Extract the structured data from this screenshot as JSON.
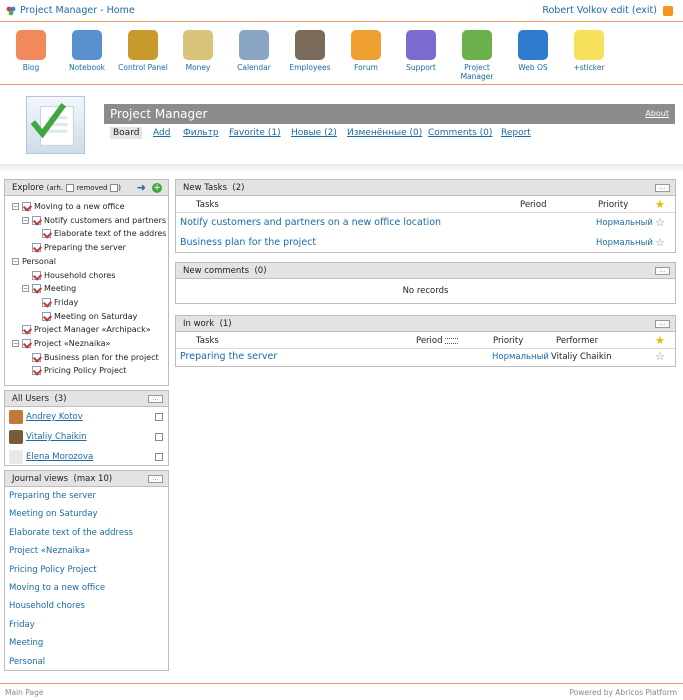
{
  "topbar": {
    "title": "Project Manager - Home",
    "user": "Robert Volkov edit (exit)"
  },
  "launcher": [
    {
      "label": "Blog",
      "icon": "blog-icon",
      "color": "#f08a5d"
    },
    {
      "label": "Notebook",
      "icon": "notebook-icon",
      "color": "#5a8fd0"
    },
    {
      "label": "Control Panel",
      "icon": "tools-icon",
      "color": "#c89a2e"
    },
    {
      "label": "Money",
      "icon": "money-icon",
      "color": "#d9c27a"
    },
    {
      "label": "Calendar",
      "icon": "calendar-icon",
      "color": "#8aa4c4"
    },
    {
      "label": "Employees",
      "icon": "employees-icon",
      "color": "#7a6a5a"
    },
    {
      "label": "Forum",
      "icon": "forum-icon",
      "color": "#f0a030"
    },
    {
      "label": "Support",
      "icon": "support-icon",
      "color": "#7b6bd0"
    },
    {
      "label": "Project\nManager",
      "icon": "project-manager-icon",
      "color": "#6ab04c"
    },
    {
      "label": "Web OS",
      "icon": "webos-icon",
      "color": "#2e7bd0"
    },
    {
      "label": "+sticker",
      "icon": "sticker-icon",
      "color": "#f5e15a"
    }
  ],
  "header": {
    "title": "Project Manager",
    "about": "About",
    "nav": [
      {
        "label": "Board",
        "active": true
      },
      {
        "label": "Add"
      },
      {
        "label": "Фильтр"
      },
      {
        "label": "Favorite (1)"
      },
      {
        "label": "Новые (2)"
      },
      {
        "label": "Изменённые (0)"
      },
      {
        "label": "Comments (0)"
      },
      {
        "label": "Report"
      }
    ]
  },
  "explore": {
    "title": "Explore",
    "arh_label": "(arh.",
    "removed_label": "removed",
    "tree": [
      {
        "label": "Moving to a new office",
        "level": 0,
        "box": "−"
      },
      {
        "label": "Notify customers and partners",
        "level": 1,
        "box": "−"
      },
      {
        "label": "Elaborate text of the addres",
        "level": 2
      },
      {
        "label": "Preparing the server",
        "level": 1
      },
      {
        "label": "Personal",
        "level": 0,
        "box": "−",
        "noicon": true
      },
      {
        "label": "Household chores",
        "level": 1
      },
      {
        "label": "Meeting",
        "level": 1,
        "box": "−"
      },
      {
        "label": "Friday",
        "level": 2
      },
      {
        "label": "Meeting on Saturday",
        "level": 2
      },
      {
        "label": "Project Manager «Archipack»",
        "level": 0
      },
      {
        "label": "Project «Neznaika»",
        "level": 0,
        "box": "−"
      },
      {
        "label": "Business plan for the project",
        "level": 1
      },
      {
        "label": "Pricing Policy Project",
        "level": 1
      }
    ]
  },
  "users": {
    "title": "All Users",
    "count": "(3)",
    "items": [
      {
        "name": "Andrey Kotov"
      },
      {
        "name": "Vitaliy Chaikin"
      },
      {
        "name": "Elena Morozova"
      }
    ]
  },
  "journal": {
    "title": "Journal views",
    "max": "(max 10)",
    "items": [
      "Preparing the server",
      "Meeting on Saturday",
      "Elaborate text of the address",
      "Project «Neznaika»",
      "Pricing Policy Project",
      "Moving to a new office",
      "Household chores",
      "Friday",
      "Meeting",
      "Personal"
    ]
  },
  "new_tasks": {
    "title": "New Tasks",
    "count": "(2)",
    "col_tasks": "Tasks",
    "col_period": "Period",
    "col_priority": "Priority",
    "rows": [
      {
        "name": "Notify customers and partners on a new office location",
        "priority": "Нормальный"
      },
      {
        "name": "Business plan for the project",
        "priority": "Нормальный"
      }
    ]
  },
  "new_comments": {
    "title": "New comments",
    "count": "(0)",
    "empty": "No records"
  },
  "in_work": {
    "title": "In work",
    "count": "(1)",
    "col_tasks": "Tasks",
    "col_period": "Period",
    "col_priority": "Priority",
    "col_performer": "Performer",
    "rows": [
      {
        "name": "Preparing the server",
        "priority": "Нормальный",
        "performer": "Vitaliy Chaikin"
      }
    ]
  },
  "footer": {
    "left": "Main Page",
    "right": "Powered by Abricos Platform"
  },
  "colors": {
    "accent_line": "#e89a6a",
    "link": "#1a6aa8",
    "title_bar": "#8c8c8c"
  }
}
